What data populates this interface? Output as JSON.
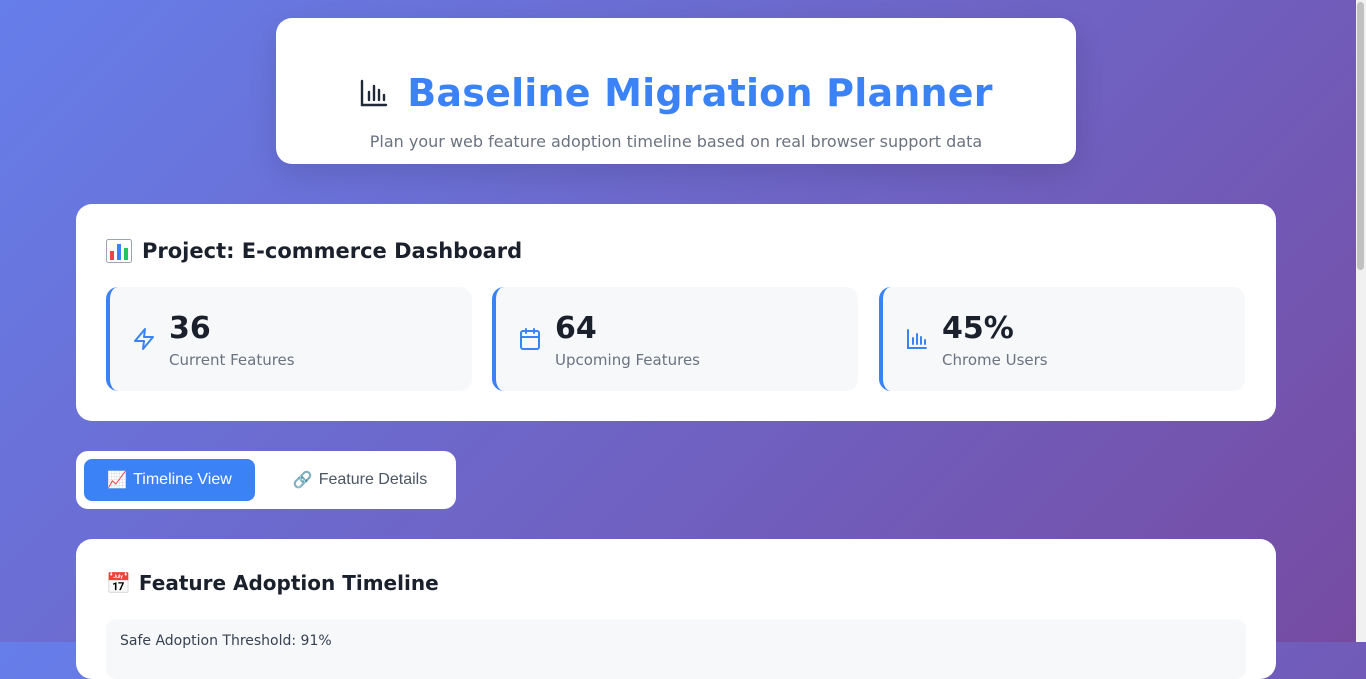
{
  "header": {
    "icon": "bar-chart-icon",
    "title": "Baseline Migration Planner",
    "subtitle": "Plan your web feature adoption timeline based on real browser support data"
  },
  "project": {
    "icon": "bar-chart-emoji",
    "title": "Project: E-commerce Dashboard",
    "stats": [
      {
        "icon": "lightning-icon",
        "value": "36",
        "label": "Current Features"
      },
      {
        "icon": "calendar-icon",
        "value": "64",
        "label": "Upcoming Features"
      },
      {
        "icon": "bar-chart-icon",
        "value": "45%",
        "label": "Chrome Users"
      }
    ]
  },
  "tabs": [
    {
      "icon": "📈",
      "label": "Timeline View",
      "active": true
    },
    {
      "icon": "🔗",
      "label": "Feature Details",
      "active": false
    }
  ],
  "timeline": {
    "icon": "📅",
    "title": "Feature Adoption Timeline",
    "threshold": "Safe Adoption Threshold: 91%"
  },
  "colors": {
    "accent": "#3b82f6",
    "bg_start": "#667eea",
    "bg_end": "#764ba2"
  }
}
